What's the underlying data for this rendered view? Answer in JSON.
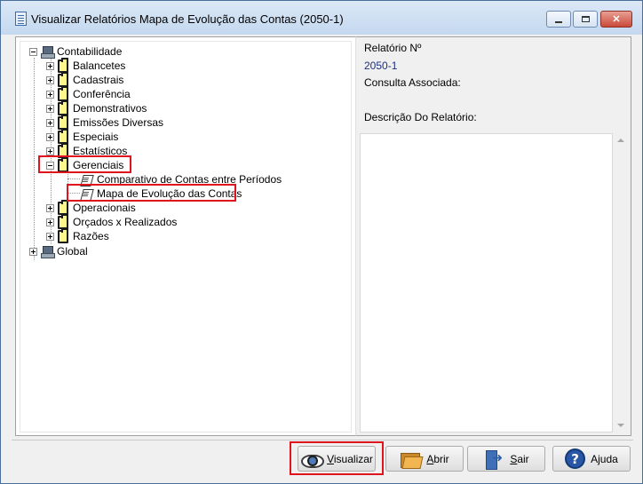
{
  "window": {
    "title": "Visualizar Relatórios Mapa de Evolução das Contas (2050-1)"
  },
  "tree": {
    "root": {
      "label": "Contabilidade"
    },
    "children": [
      {
        "label": "Balancetes"
      },
      {
        "label": "Cadastrais"
      },
      {
        "label": "Conferência"
      },
      {
        "label": "Demonstrativos"
      },
      {
        "label": "Emissões Diversas"
      },
      {
        "label": "Especiais"
      },
      {
        "label": "Estatísticos"
      },
      {
        "label": "Gerenciais"
      },
      {
        "label": "Operacionais"
      },
      {
        "label": "Orçados x Realizados"
      },
      {
        "label": "Razões"
      }
    ],
    "gerenciais_reports": [
      {
        "label": "Comparativo de Contas entre Períodos"
      },
      {
        "label": "Mapa de Evolução das Contas"
      }
    ],
    "global": {
      "label": "Global"
    }
  },
  "info": {
    "report_number_label": "Relatório Nº",
    "report_number_value": "2050-1",
    "linked_query_label": "Consulta Associada:",
    "description_label": "Descrição Do Relatório:"
  },
  "buttons": {
    "visualizar": "Visualizar",
    "abrir": "Abrir",
    "sair": "Sair",
    "ajuda": "Ajuda"
  },
  "icons": {
    "help": "?"
  },
  "colors": {
    "highlight": "#e0141e",
    "info_value": "#1c2f7e"
  }
}
